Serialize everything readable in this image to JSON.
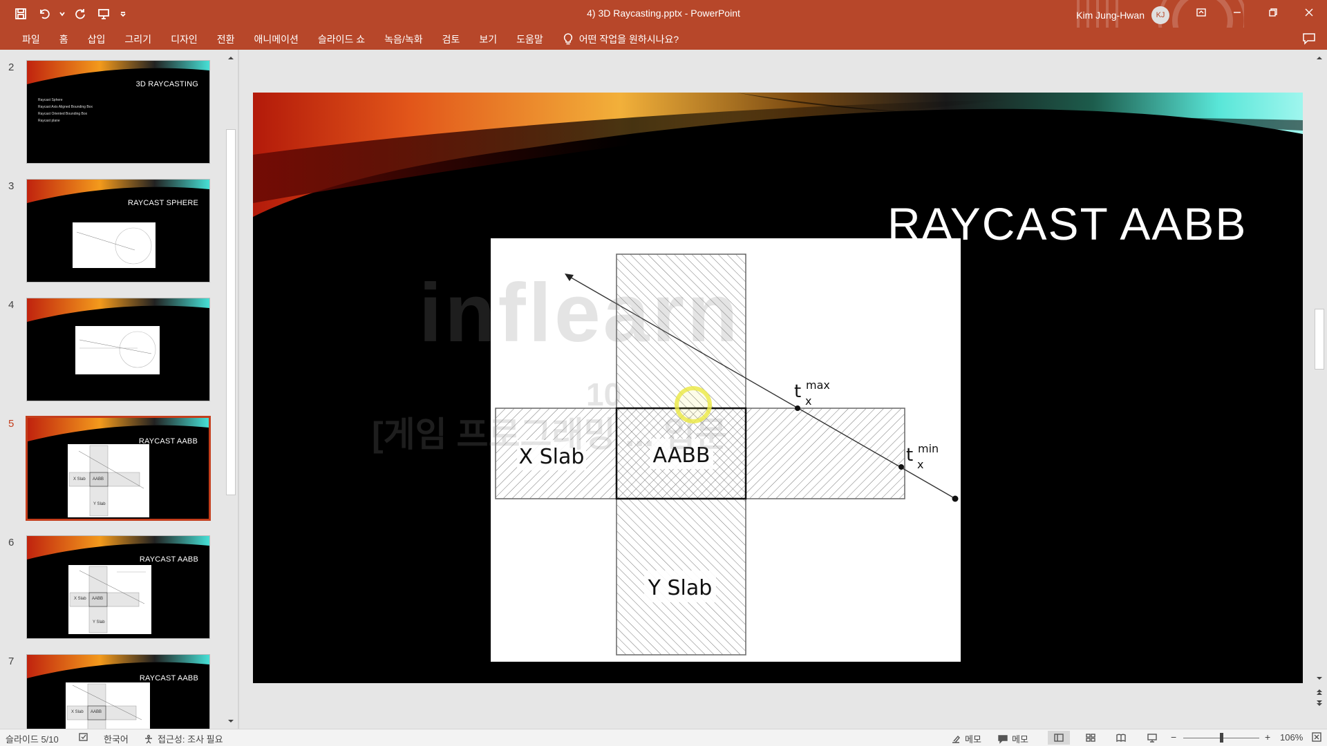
{
  "window": {
    "title": "4) 3D Raycasting.pptx  -  PowerPoint",
    "user_name": "Kim Jung-Hwan",
    "user_initials": "KJ",
    "accent": "#b7472a"
  },
  "ribbon": {
    "tabs": [
      "파일",
      "홈",
      "삽입",
      "그리기",
      "디자인",
      "전환",
      "애니메이션",
      "슬라이드 쇼",
      "녹음/녹화",
      "검토",
      "보기",
      "도움말"
    ],
    "tell_me": "어떤 작업을 원하시나요?"
  },
  "thumbnails": [
    {
      "num": "2",
      "title": "3D RAYCASTING",
      "bullets": [
        "Raycast Sphere",
        "Raycast Axis Aligned Bounding Box",
        "Raycast Oriented Bounding Box",
        "Raycast plane"
      ]
    },
    {
      "num": "3",
      "title": "RAYCAST SPHERE"
    },
    {
      "num": "4",
      "title": ""
    },
    {
      "num": "5",
      "title": "RAYCAST AABB",
      "selected": true
    },
    {
      "num": "6",
      "title": "RAYCAST AABB"
    },
    {
      "num": "7",
      "title": "RAYCAST AABB"
    }
  ],
  "slide": {
    "title": "RAYCAST AABB",
    "diagram": {
      "x_slab": "X Slab",
      "y_slab": "Y Slab",
      "aabb": "AABB",
      "tmax_base": "t",
      "tmax_sub": "x",
      "tmax_sup": "max",
      "tmin_base": "t",
      "tmin_sub": "x",
      "tmin_sup": "min"
    },
    "watermark": {
      "logo": "inflearn",
      "line2": "10",
      "line3": "[게임 프로그래밍 ... 입문"
    }
  },
  "thumb_mini": {
    "x_slab": "X Slab",
    "aabb": "AABB",
    "y_slab": "Y Slab"
  },
  "status": {
    "slide_info": "슬라이드 5/10",
    "language": "한국어",
    "accessibility": "접근성: 조사 필요",
    "notes": "메모",
    "comments": "메모",
    "zoom": "106%"
  }
}
